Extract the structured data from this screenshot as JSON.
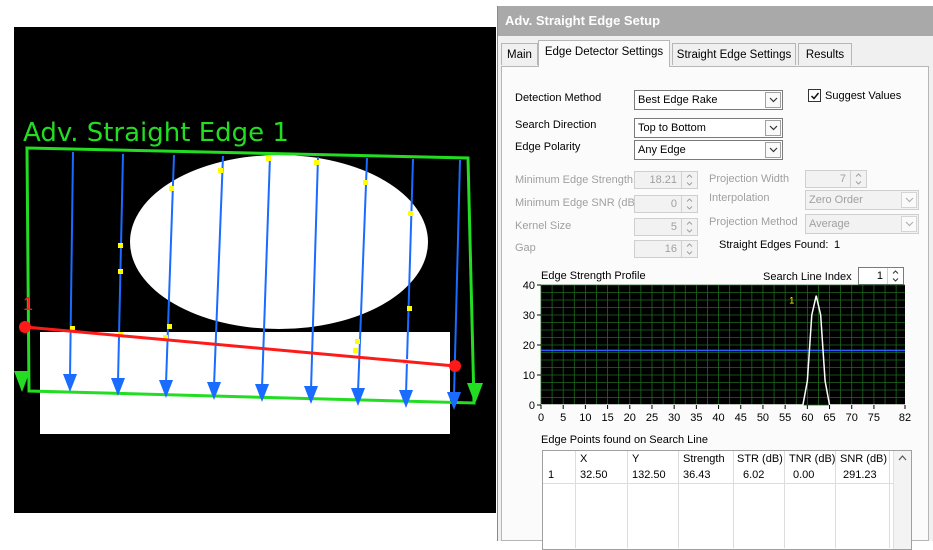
{
  "viewer": {
    "tool_label": "Adv. Straight Edge 1",
    "edge_index_label": "1"
  },
  "panel": {
    "title": "Adv. Straight Edge Setup",
    "tabs": [
      {
        "label": "Main",
        "active": false
      },
      {
        "label": "Edge Detector Settings",
        "active": true
      },
      {
        "label": "Straight Edge Settings",
        "active": false
      },
      {
        "label": "Results",
        "active": false
      }
    ],
    "detection_method": {
      "label": "Detection Method",
      "value": "Best Edge Rake"
    },
    "suggest_values": {
      "label": "Suggest Values",
      "checked": true
    },
    "search_direction": {
      "label": "Search Direction",
      "value": "Top to Bottom"
    },
    "edge_polarity": {
      "label": "Edge Polarity",
      "value": "Any Edge"
    },
    "min_edge_strength": {
      "label": "Minimum Edge Strength",
      "value": "18.21"
    },
    "min_edge_snr": {
      "label": "Minimum Edge SNR (dB)",
      "value": "0"
    },
    "kernel_size": {
      "label": "Kernel Size",
      "value": "5"
    },
    "gap": {
      "label": "Gap",
      "value": "16"
    },
    "projection_width": {
      "label": "Projection Width",
      "value": "7"
    },
    "interpolation": {
      "label": "Interpolation",
      "value": "Zero Order"
    },
    "projection_method": {
      "label": "Projection Method",
      "value": "Average"
    },
    "straight_edges_found": {
      "label": "Straight Edges Found:",
      "value": "1"
    },
    "profile": {
      "title": "Edge Strength Profile",
      "search_line_label": "Search Line Index",
      "search_line_value": "1",
      "marker_label": "1"
    },
    "edge_points": {
      "title": "Edge Points found on Search Line",
      "columns": [
        "X",
        "Y",
        "Strength",
        "STR (dB)",
        "TNR (dB)",
        "SNR (dB)"
      ],
      "rows": [
        {
          "index": "1",
          "cells": [
            "32.50",
            "132.50",
            "36.43",
            "6.02",
            "0.00",
            "291.23"
          ]
        }
      ]
    }
  },
  "colors": {
    "roi": "#22dd22",
    "rake": "#1a6bff",
    "fit_line": "#ff1a1a",
    "edge_point": "#ffff00",
    "plot_bg": "#000000",
    "plot_grid": "#1f6b1f",
    "threshold": "#2b5cff"
  },
  "chart_data": {
    "type": "line",
    "title": "Edge Strength Profile",
    "xlim": [
      0,
      82
    ],
    "ylim": [
      0,
      40
    ],
    "xticks": [
      0,
      5,
      10,
      15,
      20,
      25,
      30,
      35,
      40,
      45,
      50,
      55,
      60,
      65,
      70,
      75,
      82
    ],
    "yticks": [
      0,
      10,
      20,
      30,
      40
    ],
    "threshold": 18.21,
    "grid": true,
    "series": [
      {
        "x": [
          0,
          59,
          60,
          61,
          62,
          63,
          64,
          65,
          82
        ],
        "y": [
          0,
          0,
          8,
          30,
          36.43,
          30,
          8,
          0,
          0
        ]
      }
    ]
  }
}
